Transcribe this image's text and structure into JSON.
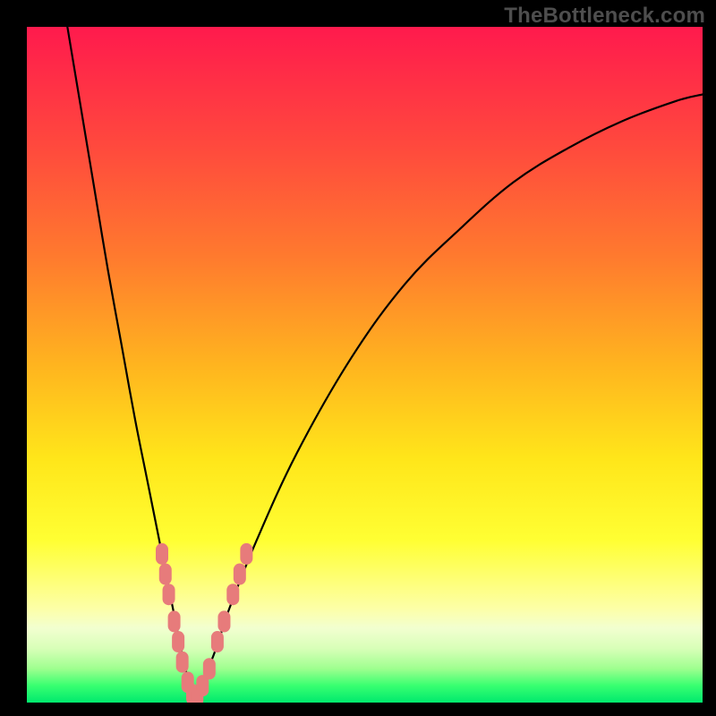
{
  "watermark": {
    "text": "TheBottleneck.com"
  },
  "chart_data": {
    "type": "line",
    "title": "",
    "xlabel": "",
    "ylabel": "",
    "xlim": [
      0,
      100
    ],
    "ylim": [
      0,
      100
    ],
    "grid": false,
    "legend": false,
    "series": [
      {
        "name": "bottleneck-curve",
        "x": [
          6,
          8,
          10,
          12,
          14,
          16,
          18,
          20,
          22,
          23,
          24,
          25,
          26,
          28,
          30,
          34,
          40,
          48,
          56,
          64,
          72,
          80,
          88,
          96,
          100
        ],
        "y": [
          100,
          88,
          76,
          64,
          53,
          42,
          32,
          22,
          12,
          7,
          3,
          1,
          3,
          8,
          14,
          24,
          37,
          51,
          62,
          70,
          77,
          82,
          86,
          89,
          90
        ]
      }
    ],
    "markers": {
      "name": "highlight-points",
      "color": "#e77b7b",
      "points": [
        {
          "x": 20.0,
          "y": 22
        },
        {
          "x": 20.5,
          "y": 19
        },
        {
          "x": 21.0,
          "y": 16
        },
        {
          "x": 21.8,
          "y": 12
        },
        {
          "x": 22.4,
          "y": 9
        },
        {
          "x": 23.0,
          "y": 6
        },
        {
          "x": 23.8,
          "y": 3
        },
        {
          "x": 24.5,
          "y": 1.2
        },
        {
          "x": 25.2,
          "y": 1.0
        },
        {
          "x": 26.0,
          "y": 2.5
        },
        {
          "x": 27.0,
          "y": 5
        },
        {
          "x": 28.2,
          "y": 9
        },
        {
          "x": 29.2,
          "y": 12
        },
        {
          "x": 30.5,
          "y": 16
        },
        {
          "x": 31.5,
          "y": 19
        },
        {
          "x": 32.5,
          "y": 22
        }
      ]
    },
    "gradient_stops": [
      {
        "pos": 0.0,
        "color": "#ff1a4d"
      },
      {
        "pos": 0.5,
        "color": "#ffb41f"
      },
      {
        "pos": 0.8,
        "color": "#ffff33"
      },
      {
        "pos": 1.0,
        "color": "#00e96e"
      }
    ]
  }
}
